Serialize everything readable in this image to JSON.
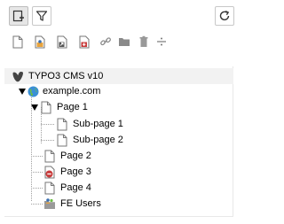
{
  "toolbar": {
    "new_page_button": "new-page-icon",
    "filter_button": "filter-icon",
    "refresh_button": "refresh-icon"
  },
  "doktype_icons": [
    "page-icon",
    "backend-user-section-icon",
    "shortcut-icon",
    "mount-point-icon",
    "link-icon",
    "folder-icon",
    "recycler-icon",
    "spacer-icon"
  ],
  "tree": {
    "root": {
      "label": "TYPO3 CMS v10",
      "icon": "typo3-logo-icon"
    },
    "site": {
      "label": "example.com",
      "icon": "globe-icon",
      "expanded": true
    },
    "pages": [
      {
        "label": "Page 1",
        "expanded": true,
        "icon": "page-icon",
        "children": [
          {
            "label": "Sub-page 1",
            "icon": "page-icon"
          },
          {
            "label": "Sub-page 2",
            "icon": "page-icon"
          }
        ]
      },
      {
        "label": "Page 2",
        "icon": "page-icon"
      },
      {
        "label": "Page 3",
        "icon": "page-restricted-icon"
      },
      {
        "label": "Page 4",
        "icon": "page-icon"
      },
      {
        "label": "FE Users",
        "icon": "folder-users-icon"
      }
    ]
  },
  "colors": {
    "accent": "#ff8700",
    "restricted": "#c83c3c",
    "globe": "#3a8fd6"
  }
}
